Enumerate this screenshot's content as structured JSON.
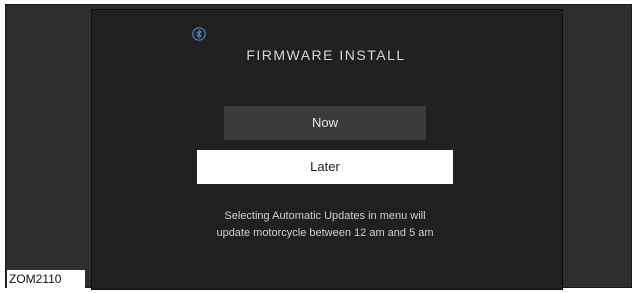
{
  "screen": {
    "title": "FIRMWARE INSTALL",
    "bluetooth_icon": "bluetooth-icon",
    "buttons": {
      "now_label": "Now",
      "later_label": "Later"
    },
    "info_line_1": "Selecting Automatic Updates in menu will",
    "info_line_2": "update motorcycle between 12 am and 5 am"
  },
  "figure_label": "ZOM2110",
  "colors": {
    "background": "#202020",
    "now_button": "#3b3b3b",
    "later_button": "#ffffff",
    "bluetooth_accent": "#4a86c8"
  }
}
